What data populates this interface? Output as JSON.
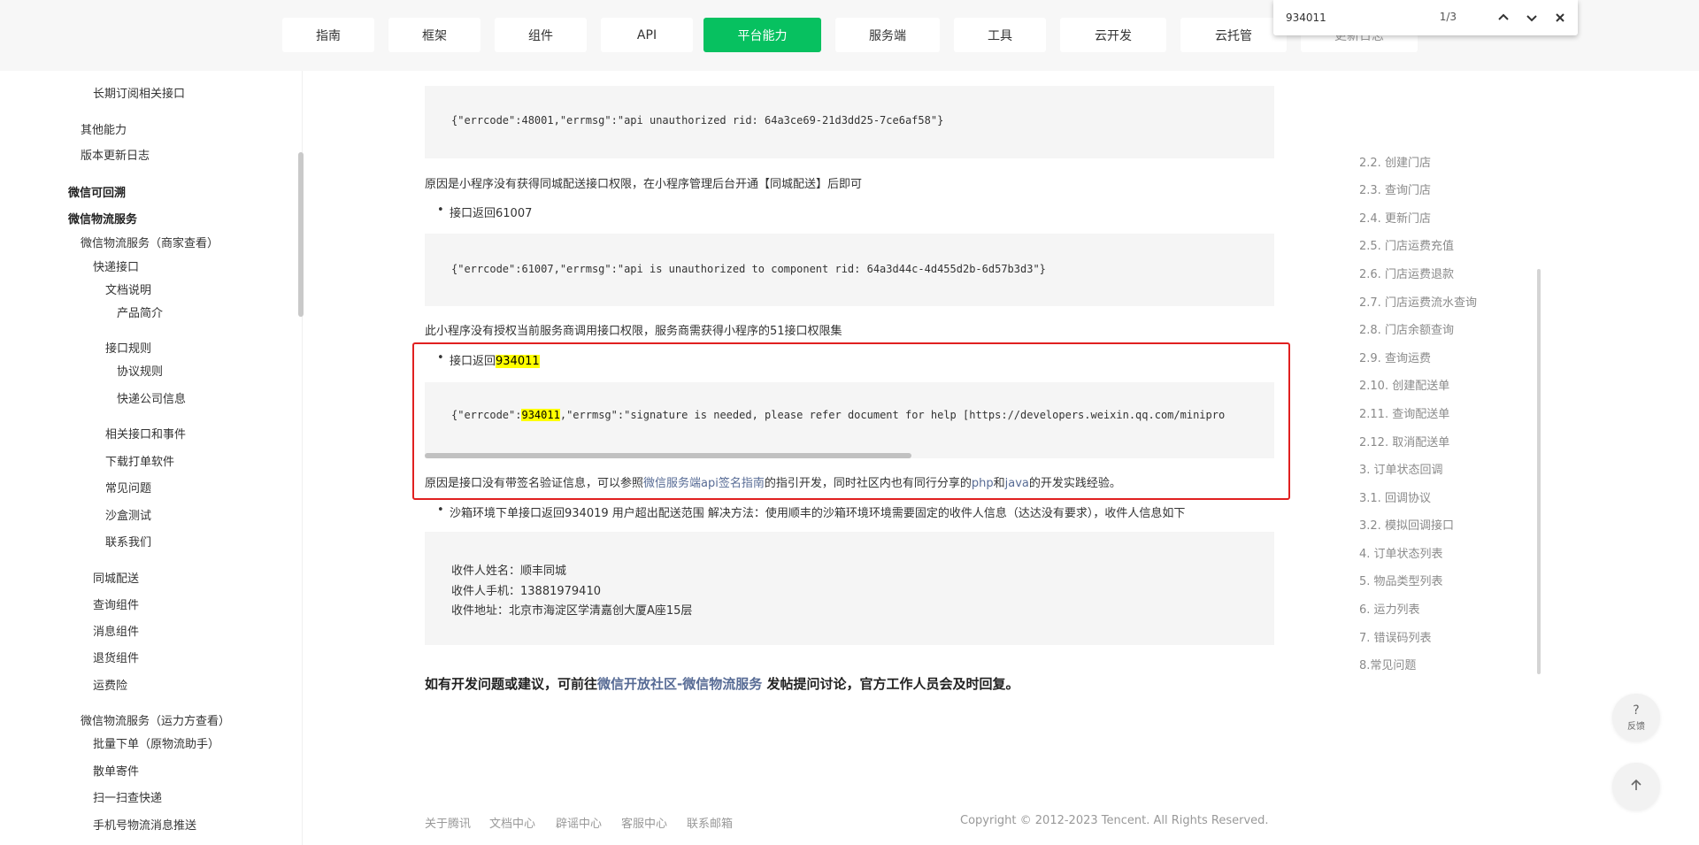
{
  "nav": {
    "tabs": [
      {
        "label": "指南"
      },
      {
        "label": "框架"
      },
      {
        "label": "组件"
      },
      {
        "label": "API"
      },
      {
        "label": "平台能力"
      },
      {
        "label": "服务端"
      },
      {
        "label": "工具"
      },
      {
        "label": "云开发"
      },
      {
        "label": "云托管"
      },
      {
        "label": "更新日志"
      }
    ],
    "active_color": "#07c160"
  },
  "findbar": {
    "query": "934011",
    "count": "1/3",
    "prev_icon": "chevron-up-icon",
    "next_icon": "chevron-down-icon",
    "close_icon": "close-icon"
  },
  "sidebar": {
    "items": [
      {
        "label": "长期订阅相关接口"
      },
      {
        "label": "其他能力"
      },
      {
        "label": "版本更新日志"
      },
      {
        "label": "微信可回溯"
      },
      {
        "label": "微信物流服务"
      },
      {
        "label": "微信物流服务（商家查看）"
      },
      {
        "label": "快递接口"
      },
      {
        "label": "文档说明"
      },
      {
        "label": "产品简介"
      },
      {
        "label": "接口规则"
      },
      {
        "label": "协议规则"
      },
      {
        "label": "快递公司信息"
      },
      {
        "label": "相关接口和事件"
      },
      {
        "label": "下载打单软件"
      },
      {
        "label": "常见问题"
      },
      {
        "label": "沙盒测试"
      },
      {
        "label": "联系我们"
      },
      {
        "label": "同城配送"
      },
      {
        "label": "查询组件"
      },
      {
        "label": "消息组件"
      },
      {
        "label": "退货组件"
      },
      {
        "label": "运费险"
      },
      {
        "label": "微信物流服务（运力方查看）"
      },
      {
        "label": "批量下单（原物流助手）"
      },
      {
        "label": "散单寄件"
      },
      {
        "label": "扫一扫查快递"
      },
      {
        "label": "手机号物流消息推送"
      }
    ]
  },
  "main": {
    "code1": "{\"errcode\":48001,\"errmsg\":\"api unauthorized rid: 64a3ce69-21d3dd25-7ce6af58\"}",
    "para1": "原因是小程序没有获得同城配送接口权限，在小程序管理后台开通【同城配送】后即可",
    "bullet1": "接口返回61007",
    "code2": "{\"errcode\":61007,\"errmsg\":\"api is unauthorized to component rid: 64a3d44c-4d455d2b-6d57b3d3\"}",
    "para2": "此小程序没有授权当前服务商调用接口权限，服务商需获得小程序的51接口权限集",
    "bullet2_prefix": "接口返回",
    "bullet2_code": "934011",
    "code3_prefix": "{\"errcode\":",
    "code3_code": "934011",
    "code3_suffix": ",\"errmsg\":\"signature is needed, please refer document for help [https://developers.weixin.qq.com/minipro",
    "para3_a": "原因是接口没有带签名验证信息，可以参照",
    "para3_link1": "微信服务端api签名指南",
    "para3_b": "的指引开发，同时社区内也有同行分享的",
    "para3_link2": "php",
    "para3_c": "和",
    "para3_link3": "java",
    "para3_d": "的开发实践经验。",
    "bullet3": "沙箱环境下单接口返回934019 用户超出配送范围 解决方法：使用顺丰的沙箱环境环境需要固定的收件人信息（达达没有要求），收件人信息如下",
    "receiver_name": "收件人姓名：顺丰同城",
    "receiver_phone": "收件人手机：13881979410",
    "receiver_addr": "收件地址：北京市海淀区学清嘉创大厦A座15层",
    "cta_a": "如有开发问题或建议，可前往",
    "cta_link": "微信开放社区-微信物流服务",
    "cta_b": " 发帖提问讨论，官方工作人员会及时回复。",
    "highlight_color": "#ffff00",
    "box_color": "#e02020",
    "link_color": "#576b95"
  },
  "footer": {
    "links": [
      "关于腾讯",
      "文档中心",
      "辟谣中心",
      "客服中心",
      "联系邮箱"
    ],
    "copyright": "Copyright © 2012-2023 Tencent. All Rights Reserved."
  },
  "toc": {
    "items": [
      "2.2. 创建门店",
      "2.3. 查询门店",
      "2.4. 更新门店",
      "2.5. 门店运费充值",
      "2.6. 门店运费退款",
      "2.7. 门店运费流水查询",
      "2.8. 门店余额查询",
      "2.9. 查询运费",
      "2.10. 创建配送单",
      "2.11. 查询配送单",
      "2.12. 取消配送单",
      "3. 订单状态回调",
      "3.1. 回调协议",
      "3.2. 模拟回调接口",
      "4. 订单状态列表",
      "5. 物品类型列表",
      "6. 运力列表",
      "7. 错误码列表",
      "8.常见问题"
    ]
  },
  "floating": {
    "feedback_q": "?",
    "feedback_label": "反馈",
    "top_icon": "arrow-up-icon"
  }
}
